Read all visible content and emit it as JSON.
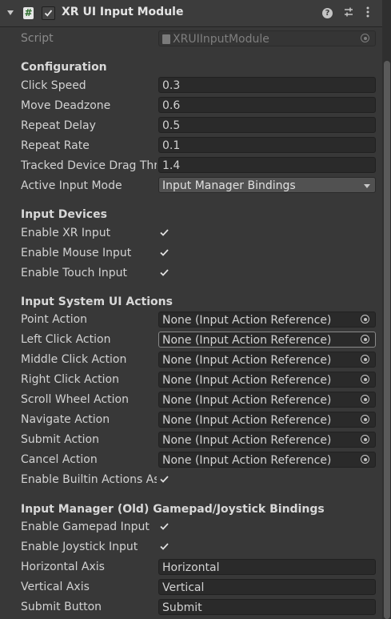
{
  "header": {
    "title": "XR UI Input Module",
    "enabled": true,
    "icons": [
      "foldout-arrow-icon",
      "csharp-script-icon",
      "help-icon",
      "presets-icon",
      "kebab-menu-icon"
    ]
  },
  "script": {
    "label": "Script",
    "value": "XRUIInputModule"
  },
  "configuration": {
    "heading": "Configuration",
    "click_speed": {
      "label": "Click Speed",
      "value": "0.3"
    },
    "move_deadzone": {
      "label": "Move Deadzone",
      "value": "0.6"
    },
    "repeat_delay": {
      "label": "Repeat Delay",
      "value": "0.5"
    },
    "repeat_rate": {
      "label": "Repeat Rate",
      "value": "0.1"
    },
    "tracked_drag": {
      "label": "Tracked Device Drag Thresh",
      "value": "1.4"
    },
    "active_input_mode": {
      "label": "Active Input Mode",
      "value": "Input Manager Bindings"
    }
  },
  "input_devices": {
    "heading": "Input Devices",
    "enable_xr": {
      "label": "Enable XR Input",
      "checked": true
    },
    "enable_mouse": {
      "label": "Enable Mouse Input",
      "checked": true
    },
    "enable_touch": {
      "label": "Enable Touch Input",
      "checked": true
    }
  },
  "ui_actions": {
    "heading": "Input System UI Actions",
    "none_value": "None (Input Action Reference)",
    "items": [
      {
        "label": "Point Action"
      },
      {
        "label": "Left Click Action"
      },
      {
        "label": "Middle Click Action"
      },
      {
        "label": "Right Click Action"
      },
      {
        "label": "Scroll Wheel Action"
      },
      {
        "label": "Navigate Action"
      },
      {
        "label": "Submit Action"
      },
      {
        "label": "Cancel Action"
      }
    ],
    "builtin": {
      "label": "Enable Builtin Actions As Fallback",
      "checked": true
    }
  },
  "gamepad": {
    "heading": "Input Manager (Old) Gamepad/Joystick Bindings",
    "enable_gamepad": {
      "label": "Enable Gamepad Input",
      "checked": true
    },
    "enable_joystick": {
      "label": "Enable Joystick Input",
      "checked": true
    },
    "horizontal_axis": {
      "label": "Horizontal Axis",
      "value": "Horizontal"
    },
    "vertical_axis": {
      "label": "Vertical Axis",
      "value": "Vertical"
    },
    "submit_button": {
      "label": "Submit Button",
      "value": "Submit"
    }
  },
  "colors": {
    "background": "#383838",
    "field": "#2a2a2a",
    "text": "#d2d2d2"
  }
}
